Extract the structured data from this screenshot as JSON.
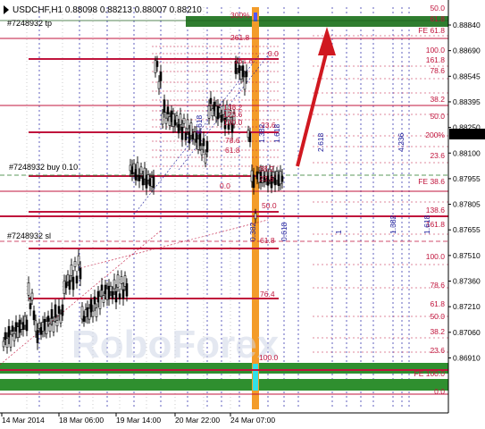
{
  "chart_data": {
    "type": "candlestick",
    "symbol_info": "USDCHF,H1 0.88098 0.88213 0.88007 0.88210",
    "watermark": "RoboForex",
    "y_axis_ticks": [
      "0.88840",
      "0.88690",
      "0.88545",
      "0.88395",
      "0.88250",
      "0.88100",
      "0.87955",
      "0.87805",
      "0.87655",
      "0.87510",
      "0.87360",
      "0.87210",
      "0.87060",
      "0.86910"
    ],
    "current_price": "0.88210",
    "ylim": [
      0.8684,
      0.8895
    ],
    "x_axis_ticks": [
      "14 Mar 2014",
      "18 Mar 06:00",
      "19 Mar 14:00",
      "20 Mar 22:00",
      "24 Mar 07:00"
    ],
    "order_labels": [
      "#7248932 tp",
      "#7248932 buy 0.10",
      "#7248932 sl"
    ],
    "fib_levels_right": [
      "50.0",
      "61.8",
      "FE 61.8",
      "100.0",
      "161.8",
      "78.6",
      "38.2",
      "50.0",
      "200%",
      "23.6",
      "FE 38.6",
      "138.6",
      "161.8",
      "100.0",
      "78.6",
      "61.8",
      "50.0",
      "38.2",
      "23.6",
      "FE 100.0",
      "0.0"
    ],
    "fib_levels_mid": [
      "300%",
      "261.8",
      "0.0",
      "161.8",
      "138.2",
      "123.6",
      "100.0",
      "23.6",
      "78.6",
      "61.8",
      "38.2",
      "23.6",
      "0.0",
      "50.0",
      "61.8",
      "76.4",
      "100.0"
    ],
    "cycle_labels": [
      "0.618",
      "1.382",
      "1.618",
      "2.618",
      "4.236",
      "1",
      "1.382",
      "1.618",
      "0.382",
      "0.618"
    ]
  }
}
